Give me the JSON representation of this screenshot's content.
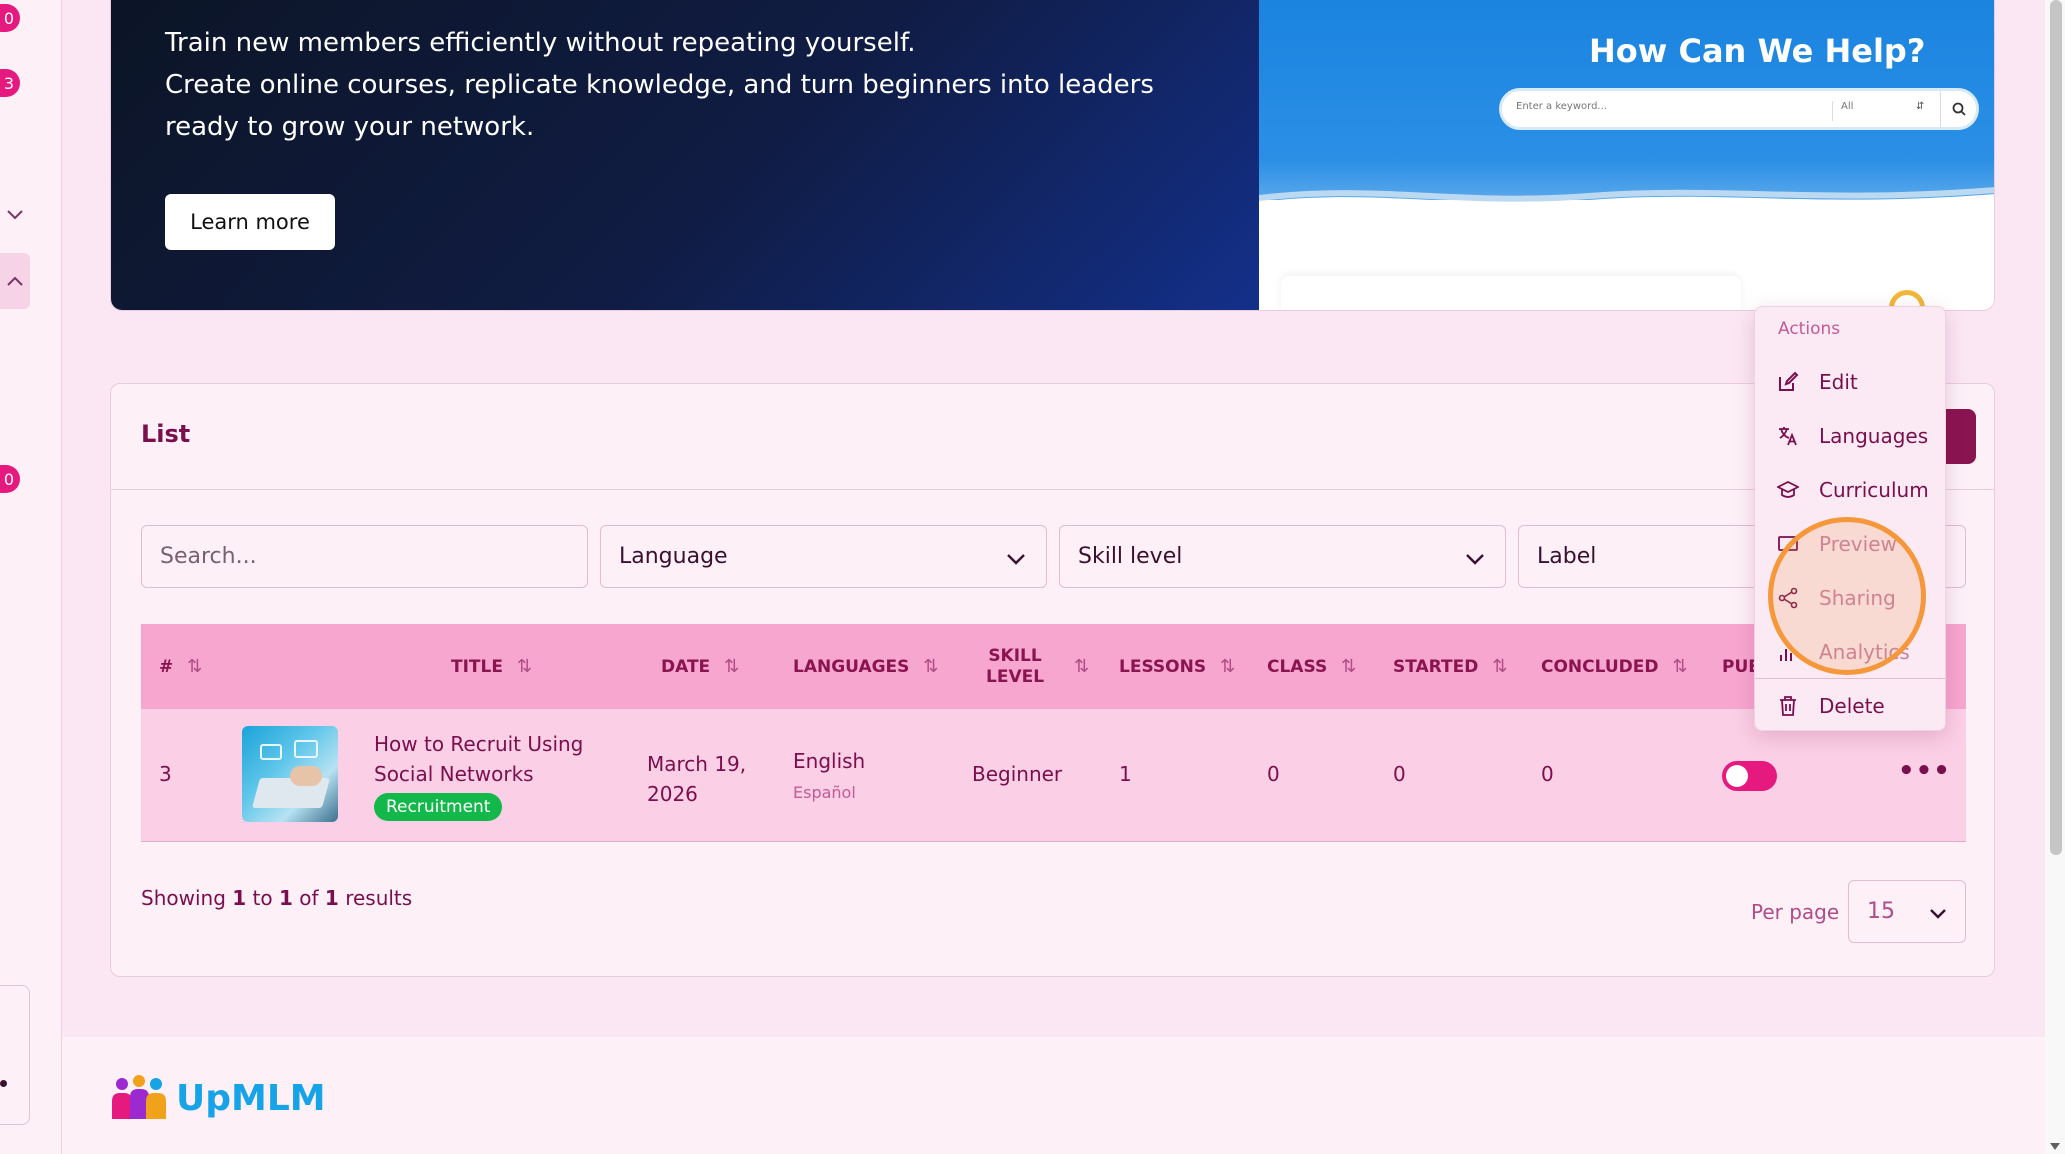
{
  "sidebar": {
    "badges": [
      "0",
      "3",
      "0"
    ]
  },
  "hero": {
    "line1": "Train new members efficiently without repeating yourself.",
    "line2": "Create online courses, replicate knowledge, and turn beginners into leaders ready to grow your network.",
    "button_label": "Learn more",
    "preview_title": "How Can We Help?",
    "preview_search_placeholder": "Enter a keyword...",
    "preview_select_value": "All"
  },
  "list": {
    "title": "List",
    "search_placeholder": "Search...",
    "filters": {
      "language": "Language",
      "skill_level": "Skill level",
      "label": "Label"
    },
    "columns": {
      "number": "#",
      "title": "TITLE",
      "date": "DATE",
      "languages": "LANGUAGES",
      "skill_level_1": "SKILL",
      "skill_level_2": "LEVEL",
      "lessons": "LESSONS",
      "class": "CLASS",
      "started": "STARTED",
      "concluded": "CONCLUDED",
      "published": "PUE"
    },
    "rows": [
      {
        "id": "3",
        "title_line1": "How to Recruit Using",
        "title_line2": "Social Networks",
        "tag": "Recruitment",
        "date_line1": "March 19,",
        "date_line2": "2026",
        "language_primary": "English",
        "language_secondary": "Español",
        "skill": "Beginner",
        "lessons": "1",
        "class": "0",
        "started": "0",
        "concluded": "0",
        "published": false
      }
    ],
    "showing": {
      "prefix": "Showing",
      "from": "1",
      "to_word": "to",
      "to": "1",
      "of_word": "of",
      "total": "1",
      "suffix": "results"
    },
    "per_page_label": "Per page",
    "per_page_value": "15"
  },
  "actions_menu": {
    "header": "Actions",
    "items": [
      {
        "label": "Edit",
        "icon": "edit-icon"
      },
      {
        "label": "Languages",
        "icon": "translate-icon"
      },
      {
        "label": "Curriculum",
        "icon": "graduation-cap-icon"
      },
      {
        "label": "Preview",
        "icon": "preview-icon"
      },
      {
        "label": "Sharing",
        "icon": "share-icon"
      },
      {
        "label": "Analytics",
        "icon": "analytics-icon"
      },
      {
        "label": "Delete",
        "icon": "trash-icon"
      }
    ]
  },
  "footer": {
    "logo_text": "UpMLM"
  },
  "colors": {
    "accent": "#8a1450",
    "brand_pink": "#e5197e",
    "table_header": "#f7a6d0",
    "tag_green": "#12b84a",
    "highlight_orange": "#f6973a",
    "logo_blue": "#16a3e8"
  }
}
